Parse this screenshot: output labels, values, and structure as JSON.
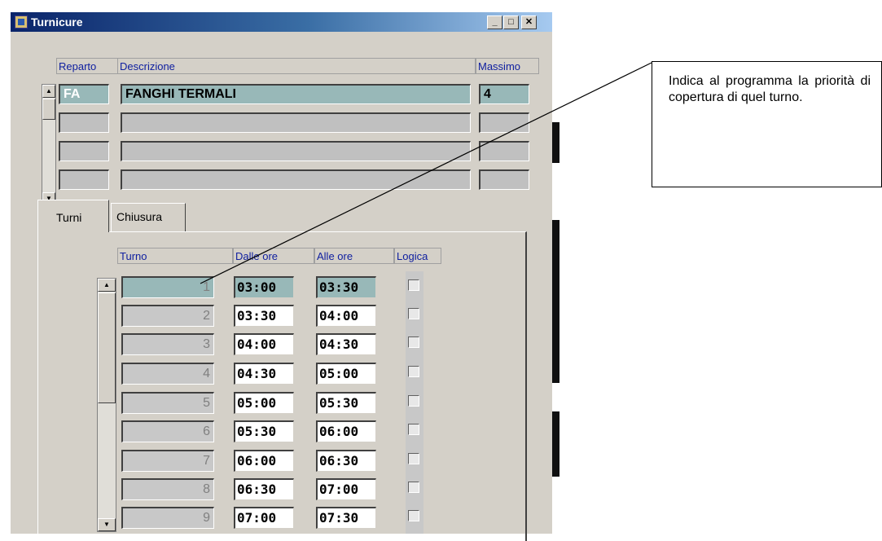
{
  "window": {
    "title": "Turnicure",
    "controls": {
      "minimize": "_",
      "maximize": "□",
      "close": "✕"
    }
  },
  "form": {
    "headers": {
      "reparto": "Reparto",
      "descrizione": "Descrizione",
      "massimo": "Massimo"
    },
    "rows": [
      {
        "reparto": "FA",
        "descrizione": "FANGHI TERMALI",
        "massimo": "4"
      },
      {
        "reparto": "",
        "descrizione": "",
        "massimo": ""
      },
      {
        "reparto": "",
        "descrizione": "",
        "massimo": ""
      },
      {
        "reparto": "",
        "descrizione": "",
        "massimo": ""
      }
    ]
  },
  "tabs": [
    {
      "label": "Turni",
      "active": true
    },
    {
      "label": "Chiusura",
      "active": false
    }
  ],
  "turni": {
    "headers": {
      "turno": "Turno",
      "dalle": "Dalle ore",
      "alle": "Alle ore",
      "logica": "Logica"
    },
    "rows": [
      {
        "turno": "1",
        "dalle": "03:00",
        "alle": "03:30"
      },
      {
        "turno": "2",
        "dalle": "03:30",
        "alle": "04:00"
      },
      {
        "turno": "3",
        "dalle": "04:00",
        "alle": "04:30"
      },
      {
        "turno": "4",
        "dalle": "04:30",
        "alle": "05:00"
      },
      {
        "turno": "5",
        "dalle": "05:00",
        "alle": "05:30"
      },
      {
        "turno": "6",
        "dalle": "05:30",
        "alle": "06:00"
      },
      {
        "turno": "7",
        "dalle": "06:00",
        "alle": "06:30"
      },
      {
        "turno": "8",
        "dalle": "06:30",
        "alle": "07:00"
      },
      {
        "turno": "9",
        "dalle": "07:00",
        "alle": "07:30"
      }
    ]
  },
  "callout": {
    "text": "Indica al programma la priorità di copertura di quel turno."
  },
  "colors": {
    "selected_field": "#98b8b8",
    "label_blue": "#1020a0",
    "window_bg": "#d4d0c8"
  }
}
